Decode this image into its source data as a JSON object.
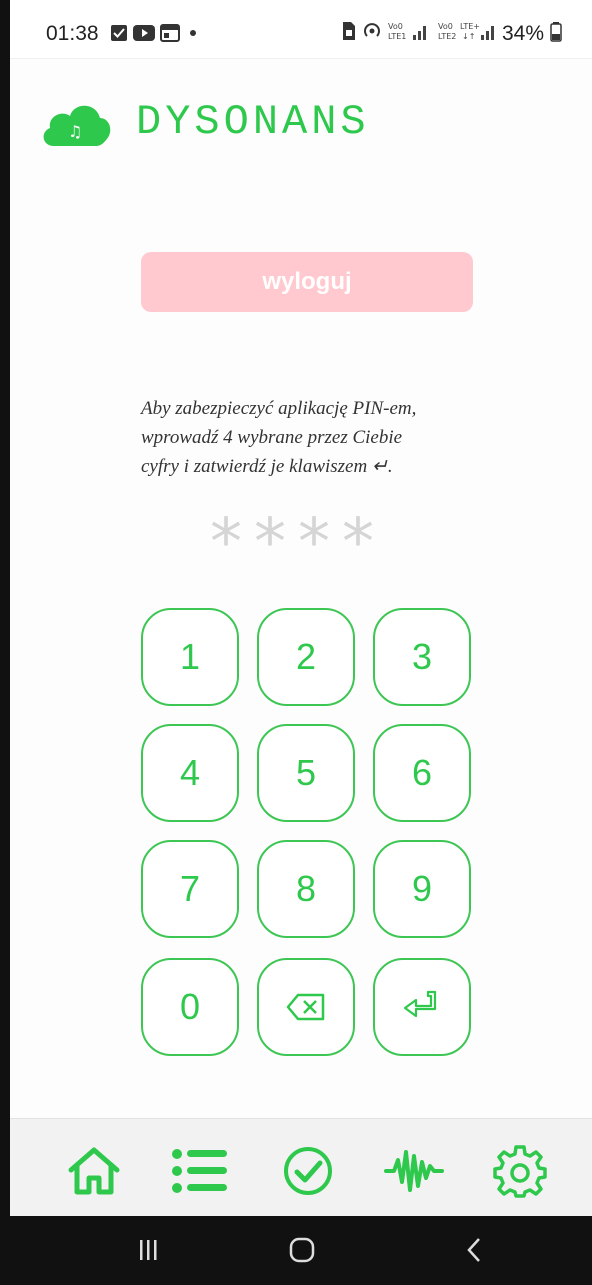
{
  "status_bar": {
    "time": "01:38",
    "battery": "34%",
    "icons_left": [
      "checkbox-icon",
      "youtube-icon",
      "window-icon",
      "dot-icon"
    ],
    "icons_right": [
      "sim-icon",
      "hotspot-icon",
      "volte1-signal-icon",
      "volte2-lte-signal-icon",
      "battery-icon"
    ]
  },
  "app": {
    "brand": "DYSONANS",
    "logo_icon": "cloud-music-icon",
    "accent_color": "#2ec84c",
    "logout_color": "#ffc9cf"
  },
  "logout": {
    "label": "wyloguj"
  },
  "instructions": {
    "line1": "Aby zabezpieczyć aplikację PIN-em,",
    "line2": "wprowadź 4 wybrane przez Ciebie",
    "line3": "cyfry i zatwierdź je klawiszem ↵."
  },
  "pin": {
    "mask": [
      "*",
      "*",
      "*",
      "*"
    ]
  },
  "keypad": {
    "k1": "1",
    "k2": "2",
    "k3": "3",
    "k4": "4",
    "k5": "5",
    "k6": "6",
    "k7": "7",
    "k8": "8",
    "k9": "9",
    "k0": "0",
    "backspace_icon": "backspace-icon",
    "enter_icon": "enter-icon"
  },
  "bottom_nav": [
    "home-icon",
    "list-icon",
    "check-circle-icon",
    "waveform-icon",
    "settings-icon"
  ],
  "system_nav": [
    "recent-apps-icon",
    "home-icon",
    "back-icon"
  ]
}
